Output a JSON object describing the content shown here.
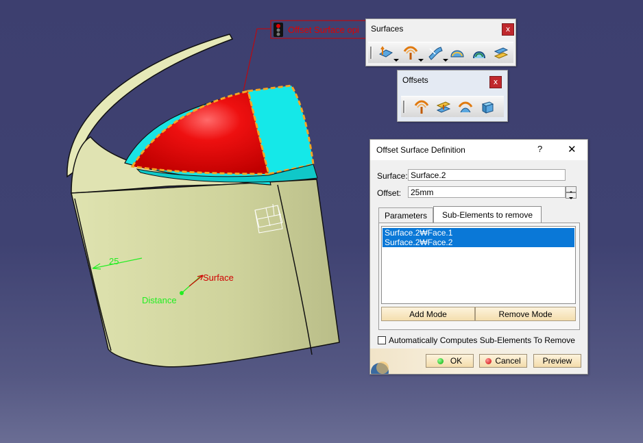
{
  "viewport": {
    "callout_text": "Offset Surface opi",
    "dimension_value": "25",
    "label_surface": "Surface",
    "label_distance": "Distance",
    "colors": {
      "background": "#3f4272",
      "surface_body": "#d2d7a0",
      "red_face": "#e00000",
      "cyan_face": "#16e6e6",
      "highlight_dash": "#f5a623",
      "callout_red": "#d00000",
      "annotation_green": "#22ee22"
    }
  },
  "toolbar_surfaces": {
    "title": "Surfaces",
    "close_label": "x",
    "icons": [
      "extrude-icon",
      "offset-icon",
      "sweep-icon",
      "fill-icon",
      "multi-section-icon",
      "blend-icon"
    ]
  },
  "toolbar_offsets": {
    "title": "Offsets",
    "close_label": "x",
    "icons": [
      "offset-icon",
      "variable-offset-icon",
      "rough-offset-icon",
      "thickness-icon"
    ]
  },
  "dialog": {
    "title": "Offset Surface Definition",
    "help_label": "?",
    "close_label": "✕",
    "surface_label": "Surface:",
    "surface_value": "Surface.2",
    "offset_label": "Offset:",
    "offset_value": "25mm",
    "tabs": [
      "Parameters",
      "Sub-Elements to remove"
    ],
    "active_tab": "Sub-Elements to remove",
    "list_items": [
      "Surface.2₩Face.1",
      "Surface.2₩Face.2"
    ],
    "add_mode_label": "Add Mode",
    "remove_mode_label": "Remove Mode",
    "auto_compute_label": "Automatically Computes Sub-Elements To Remove",
    "auto_compute_checked": false,
    "ok_label": "OK",
    "cancel_label": "Cancel",
    "preview_label": "Preview"
  }
}
